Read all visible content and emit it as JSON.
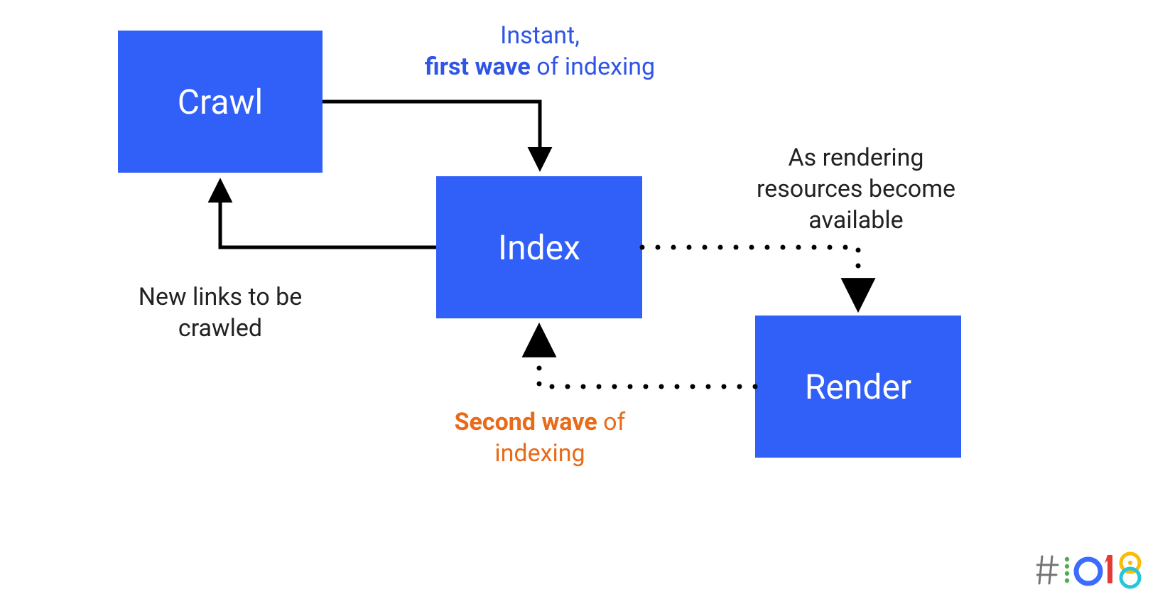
{
  "boxes": {
    "crawl": "Crawl",
    "index": "Index",
    "render": "Render"
  },
  "labels": {
    "first_wave_line1": "Instant,",
    "first_wave_bold": "first wave",
    "first_wave_rest": " of indexing",
    "new_links_line1": "New links to be",
    "new_links_line2": "crawled",
    "rendering_line1": "As rendering",
    "rendering_line2": "resources become",
    "rendering_line3": "available",
    "second_wave_bold": "Second wave",
    "second_wave_rest": " of",
    "second_wave_line2": "indexing"
  },
  "logo_alt": "#io18"
}
